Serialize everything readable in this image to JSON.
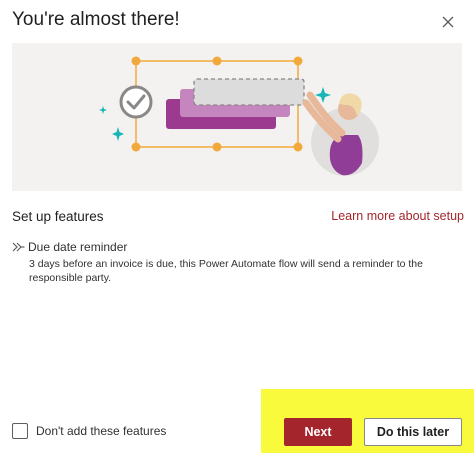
{
  "dialog": {
    "title": "You're almost there!",
    "close_icon": "close-icon"
  },
  "hero": {
    "illustration": "setup-features-illustration"
  },
  "section": {
    "header": "Set up features",
    "learn_more_label": "Learn more about setup"
  },
  "features": [
    {
      "icon": "flow-icon",
      "title": "Due date reminder",
      "description": "3 days before an invoice is due, this Power Automate flow will send a reminder to the responsible party."
    }
  ],
  "footer": {
    "checkbox_label": "Don't add these features",
    "checkbox_checked": false,
    "next_label": "Next",
    "later_label": "Do this later"
  },
  "colors": {
    "accent": "#a4262c",
    "highlight": "#fafa3c",
    "hero_background": "#f3f2f1"
  }
}
